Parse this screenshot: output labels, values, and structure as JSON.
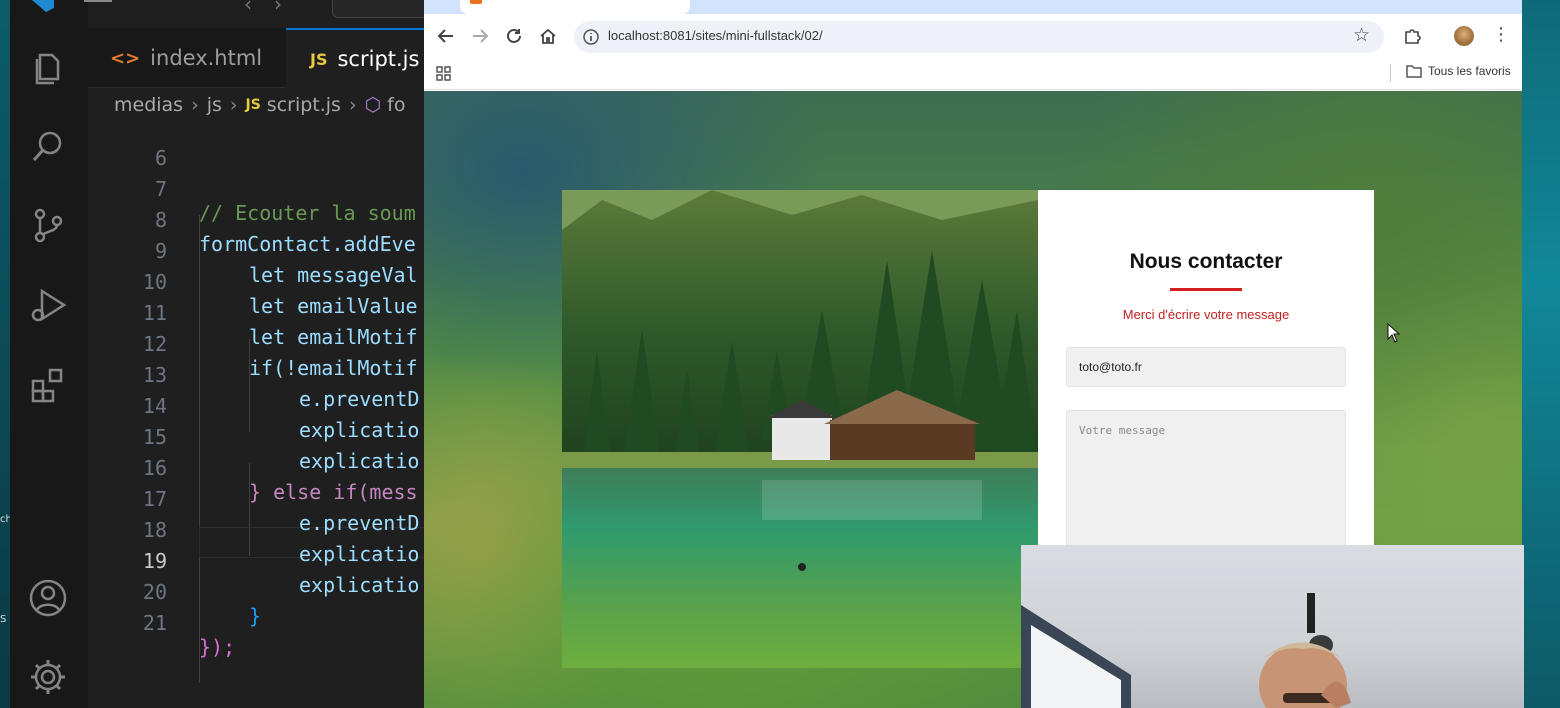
{
  "vscode": {
    "tabs": [
      {
        "label": "index.html",
        "icon": "html-file-icon"
      },
      {
        "label": "script.js",
        "icon": "js-file-icon",
        "active": true
      }
    ],
    "breadcrumb": {
      "part1": "medias",
      "part2": "js",
      "part3": "script.js",
      "part4": "fo"
    },
    "code_lines": [
      {
        "n": "6",
        "text": ""
      },
      {
        "n": "7",
        "text": "// Ecouter la soum"
      },
      {
        "n": "8",
        "text": "formContact.addEve"
      },
      {
        "n": "9",
        "text": "let messageVal"
      },
      {
        "n": "10",
        "text": "let emailValue"
      },
      {
        "n": "11",
        "text": "let emailMotif"
      },
      {
        "n": "12",
        "text": "if(!emailMotif"
      },
      {
        "n": "13",
        "text": "e.preventD"
      },
      {
        "n": "14",
        "text": "explicatio"
      },
      {
        "n": "15",
        "text": "explicatio"
      },
      {
        "n": "16",
        "text": "} else if(mess"
      },
      {
        "n": "17",
        "text": "e.preventD"
      },
      {
        "n": "18",
        "text": "explicatio"
      },
      {
        "n": "19",
        "text": "explicatio"
      },
      {
        "n": "20",
        "text": "}"
      },
      {
        "n": "21",
        "text": "});"
      }
    ],
    "current_line": "19"
  },
  "browser": {
    "url": "localhost:8081/sites/mini-fullstack/02/",
    "bookmarks_folder": "Tous les favoris"
  },
  "page": {
    "title": "Nous contacter",
    "subtitle": "Merci d'écrire votre message",
    "email_value": "toto@toto.fr",
    "message_placeholder": "Votre message"
  },
  "colors": {
    "accent_red": "#d42020",
    "vscode_bg": "#1f1f1f",
    "chrome_tab_strip": "#d3e3fd"
  },
  "desktop": {
    "edge_text_1": "ch",
    "edge_text_2": "S"
  }
}
